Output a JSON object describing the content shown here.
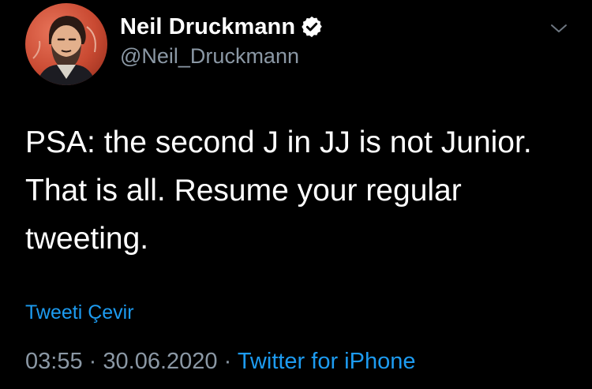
{
  "author": {
    "display_name": "Neil Druckmann",
    "handle": "@Neil_Druckmann",
    "verified": true,
    "avatar_icon": "illustrated-portrait-avatar"
  },
  "tweet": {
    "lines": [
      "PSA: the second J in JJ is not Junior.",
      "That is all. Resume your regular",
      "tweeting."
    ]
  },
  "translate_label": "Tweeti Çevir",
  "meta": {
    "time": "03:55",
    "separator": "·",
    "date": "30.06.2020",
    "source": "Twitter for iPhone"
  },
  "colors": {
    "background": "#000000",
    "text": "#ffffff",
    "secondary": "#8b98a5",
    "link": "#1d9bf0"
  },
  "icons": {
    "verified": "verified-badge-icon",
    "more": "chevron-down-icon"
  }
}
